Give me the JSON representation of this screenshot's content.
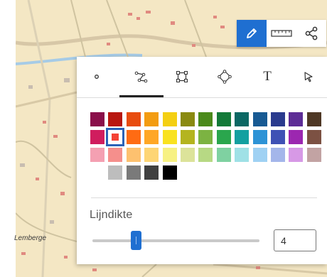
{
  "map": {
    "place_label": "Lemberge"
  },
  "toolbar": {
    "buttons": [
      "pencil-icon",
      "ruler-icon",
      "share-icon"
    ],
    "active": "pencil-icon"
  },
  "panel": {
    "tabs": [
      "point-tool-icon",
      "polyline-tool-icon",
      "rectangle-tool-icon",
      "polygon-tool-icon",
      "T",
      "select-tool-icon"
    ],
    "active_tab": 1,
    "palette": [
      [
        "#8a0f4a",
        "#b81710",
        "#e84c0e",
        "#f39c11",
        "#f4cf12",
        "#8a8a10",
        "#4b8a1b",
        "#137a38",
        "#0c6864",
        "#185a93",
        "#2a3b8e",
        "#5d2d96",
        "#4f3825"
      ],
      [
        "#d01d5e",
        "#f44336",
        "#ff6b13",
        "#ffa726",
        "#f9e21f",
        "#b4b41f",
        "#7cb342",
        "#2aa64d",
        "#13a0a0",
        "#2d93d6",
        "#3f51b5",
        "#9c27b0",
        "#7c5143"
      ],
      [
        "#f4a0b2",
        "#f58f8c",
        "#fdc16f",
        "#fdd575",
        "#f7f183",
        "#dce39a",
        "#b7d984",
        "#7fd1a1",
        "#9fe1e6",
        "#9fd1f3",
        "#a4b6ea",
        "#d799e6",
        "#c2a3a3"
      ],
      [
        "#bdbdbd",
        "#7a7a7a",
        "#404040",
        "#000000"
      ]
    ],
    "selected_color": "#f44336",
    "line_width_label": "Lijndikte",
    "line_width_value": "4",
    "slider_fraction": 0.26
  }
}
